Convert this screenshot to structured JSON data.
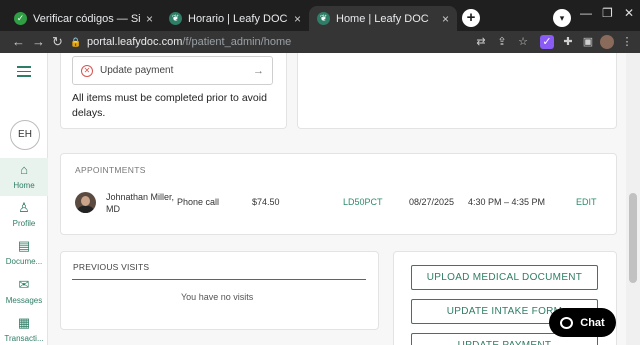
{
  "browser": {
    "tabs": [
      {
        "title": "Verificar códigos — SimplyCodes",
        "favicon": "check-icon"
      },
      {
        "title": "Horario | Leafy DOC",
        "favicon": "leafy-icon"
      },
      {
        "title": "Home | Leafy DOC",
        "favicon": "leafy-icon",
        "active": true
      }
    ],
    "url_host": "portal.leafydoc.com",
    "url_path": "/f/patient_admin/home"
  },
  "sidebar": {
    "avatar_initials": "EH",
    "items": [
      {
        "label": "Home",
        "icon": "home-icon",
        "active": true
      },
      {
        "label": "Profile",
        "icon": "profile-icon"
      },
      {
        "label": "Docume...",
        "icon": "document-icon"
      },
      {
        "label": "Messages",
        "icon": "mail-icon"
      },
      {
        "label": "Transacti...",
        "icon": "transaction-icon"
      }
    ]
  },
  "tasks": {
    "update_payment_label": "Update payment",
    "warning": "All items must be completed prior to avoid delays."
  },
  "appointments": {
    "heading": "APPOINTMENTS",
    "rows": [
      {
        "doctor": "Johnathan Miller, MD",
        "type": "Phone call",
        "price": "$74.50",
        "code": "LD50PCT",
        "date": "08/27/2025",
        "time": "4:30 PM – 4:35 PM",
        "action": "EDIT"
      }
    ]
  },
  "previous_visits": {
    "heading": "PREVIOUS VISITS",
    "empty": "You have no visits"
  },
  "actions": {
    "upload": "UPLOAD MEDICAL DOCUMENT",
    "intake": "UPDATE INTAKE FORM",
    "payment": "UPDATE PAYMENT"
  },
  "chat_label": "Chat",
  "colors": {
    "accent": "#2e7d66",
    "error": "#d9534f"
  }
}
